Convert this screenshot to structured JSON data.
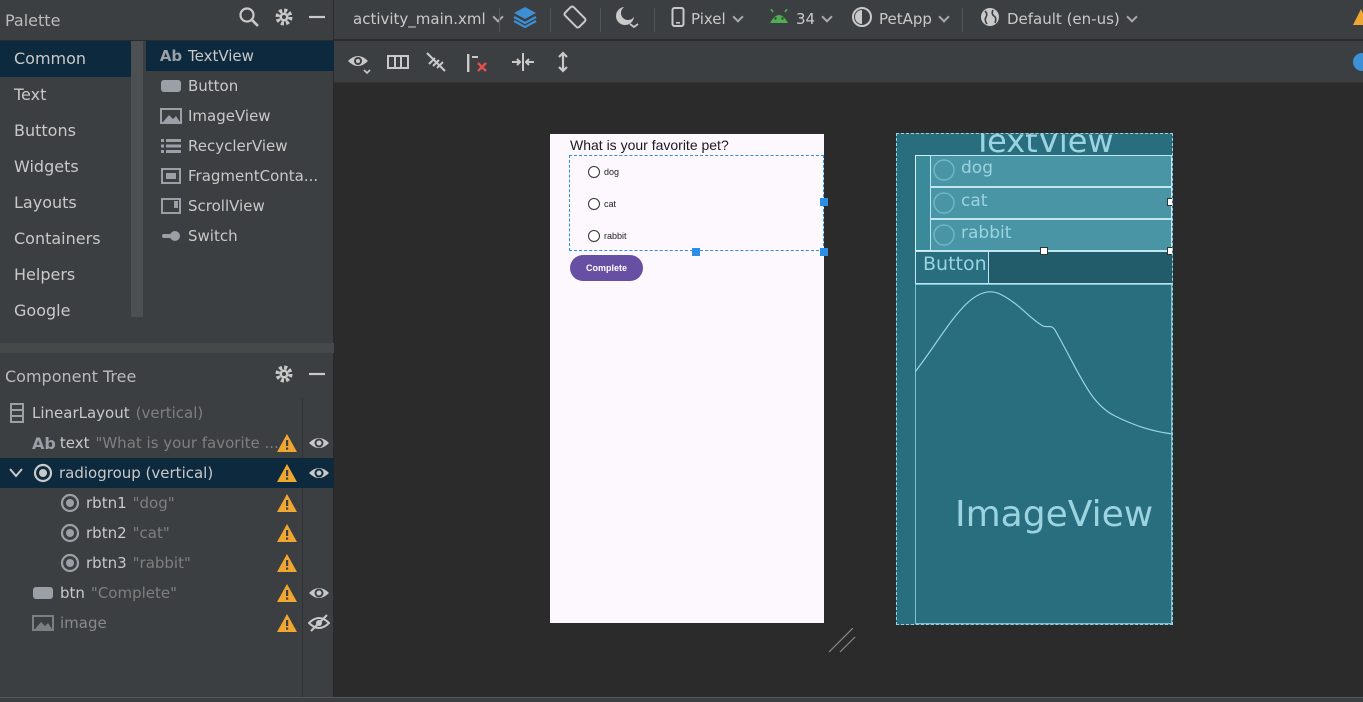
{
  "palette": {
    "title": "Palette",
    "categories": [
      "Common",
      "Text",
      "Buttons",
      "Widgets",
      "Layouts",
      "Containers",
      "Helpers",
      "Google"
    ],
    "selected_category": "Common",
    "items": [
      {
        "label": "TextView",
        "icon": "textview-icon",
        "glyph": "Ab"
      },
      {
        "label": "Button",
        "icon": "button-icon"
      },
      {
        "label": "ImageView",
        "icon": "imageview-icon"
      },
      {
        "label": "RecyclerView",
        "icon": "recyclerview-icon"
      },
      {
        "label": "FragmentConta...",
        "icon": "fragment-container-icon"
      },
      {
        "label": "ScrollView",
        "icon": "scrollview-icon"
      },
      {
        "label": "Switch",
        "icon": "switch-icon"
      }
    ]
  },
  "component_tree": {
    "title": "Component Tree",
    "rows": [
      {
        "id": "LinearLayout",
        "detail": "(vertical)",
        "icon": "linearlayout-icon",
        "warn": false,
        "eye": ""
      },
      {
        "id": "text",
        "detail": "\"What is your favorite ...",
        "icon": "textview-icon",
        "glyph": "Ab",
        "warn": true,
        "eye": "visible"
      },
      {
        "id": "radiogroup (vertical)",
        "detail": "",
        "icon": "radiogroup-icon",
        "warn": true,
        "eye": "visible",
        "selected": true
      },
      {
        "id": "rbtn1",
        "detail": "\"dog\"",
        "icon": "radiobutton-icon",
        "warn": true,
        "eye": ""
      },
      {
        "id": "rbtn2",
        "detail": "\"cat\"",
        "icon": "radiobutton-icon",
        "warn": true,
        "eye": ""
      },
      {
        "id": "rbtn3",
        "detail": "\"rabbit\"",
        "icon": "radiobutton-icon",
        "warn": true,
        "eye": ""
      },
      {
        "id": "btn",
        "detail": "\"Complete\"",
        "icon": "button-icon",
        "warn": true,
        "eye": "visible"
      },
      {
        "id": "image",
        "detail": "",
        "icon": "imageview-icon",
        "warn": true,
        "eye": "hidden",
        "dim": true
      }
    ]
  },
  "toolbar": {
    "file": "activity_main.xml",
    "device": "Pixel",
    "api": "34",
    "theme": "PetApp",
    "locale": "Default (en-us)"
  },
  "design": {
    "question": "What is your favorite pet?",
    "options": [
      "dog",
      "cat",
      "rabbit"
    ],
    "button": "Complete"
  },
  "blueprint": {
    "textview_label": "TextView",
    "options": [
      "dog",
      "cat",
      "rabbit"
    ],
    "button_label": "Button",
    "imageview_label": "ImageView"
  },
  "colors": {
    "selection": "#0d293e",
    "accent_blue": "#2d8ee6",
    "button_purple": "#6750a4",
    "blueprint_bg": "#286e7f",
    "warning": "#f0a732"
  }
}
